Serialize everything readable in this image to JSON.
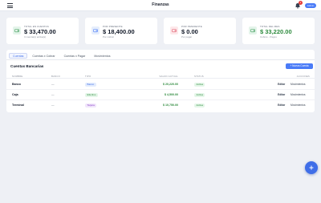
{
  "header": {
    "title": "Finanzas",
    "notification_count": "1",
    "user_label": "Admin"
  },
  "summary_cards": [
    {
      "label": "TOTAL EN CUENTAS",
      "value": "$ 33,470.00",
      "sub": "3 cuenta(s) activa(s)",
      "icon": "wallet-icon",
      "icon_bg": "#e4f4ea",
      "icon_color": "#3a9a55"
    },
    {
      "label": "POR PRESENTE",
      "value": "$ 18,400.00",
      "sub": "Por cobrar",
      "icon": "wallet-icon",
      "icon_bg": "#e6eefc",
      "icon_color": "#4a7bf7"
    },
    {
      "label": "POR PENDIENTE",
      "value": "$ 0.00",
      "sub": "Por pagar",
      "icon": "wallet-icon",
      "icon_bg": "#fde8ea",
      "icon_color": "#e0576a"
    },
    {
      "label": "TOTAL DEL MES",
      "value": "$ 33,220.00",
      "sub": "Cobros - Pagos",
      "icon": "wallet-icon",
      "icon_bg": "#e4f4ea",
      "icon_color": "#3a9a55"
    }
  ],
  "tabs": [
    {
      "label": "Cuentas",
      "active": true
    },
    {
      "label": "Cuentas x Cobrar",
      "active": false
    },
    {
      "label": "Cuentas x Pagar",
      "active": false
    },
    {
      "label": "Movimientos",
      "active": false
    }
  ],
  "section": {
    "title": "Cuentas Bancarias",
    "new_button": "+ Nueva Cuenta"
  },
  "table": {
    "headers": [
      "NOMBRE",
      "BANCO",
      "TIPO",
      "SALDO ACTUAL",
      "STATUS",
      "ACCIONES"
    ],
    "rows": [
      {
        "name": "Banco",
        "bank": "—",
        "type": "Banco",
        "type_bg": "#e3ecfd",
        "type_color": "#3f6ee8",
        "balance": "$ 20,220.00",
        "status": "Activa",
        "edit": "Editar",
        "moves": "Movimientos"
      },
      {
        "name": "Caja",
        "bank": "—",
        "type": "Efectivo",
        "type_bg": "#e4f6e8",
        "type_color": "#2e8b3e",
        "balance": "$ 4,500.00",
        "status": "Activa",
        "edit": "Editar",
        "moves": "Movimientos"
      },
      {
        "name": "Terminal",
        "bank": "—",
        "type": "Tarjeta",
        "type_bg": "#f1e6fb",
        "type_color": "#8a44c8",
        "balance": "$ 10,750.00",
        "status": "Activa",
        "edit": "Editar",
        "moves": "Movimientos"
      }
    ]
  },
  "fab": {
    "icon": "plus-icon"
  }
}
